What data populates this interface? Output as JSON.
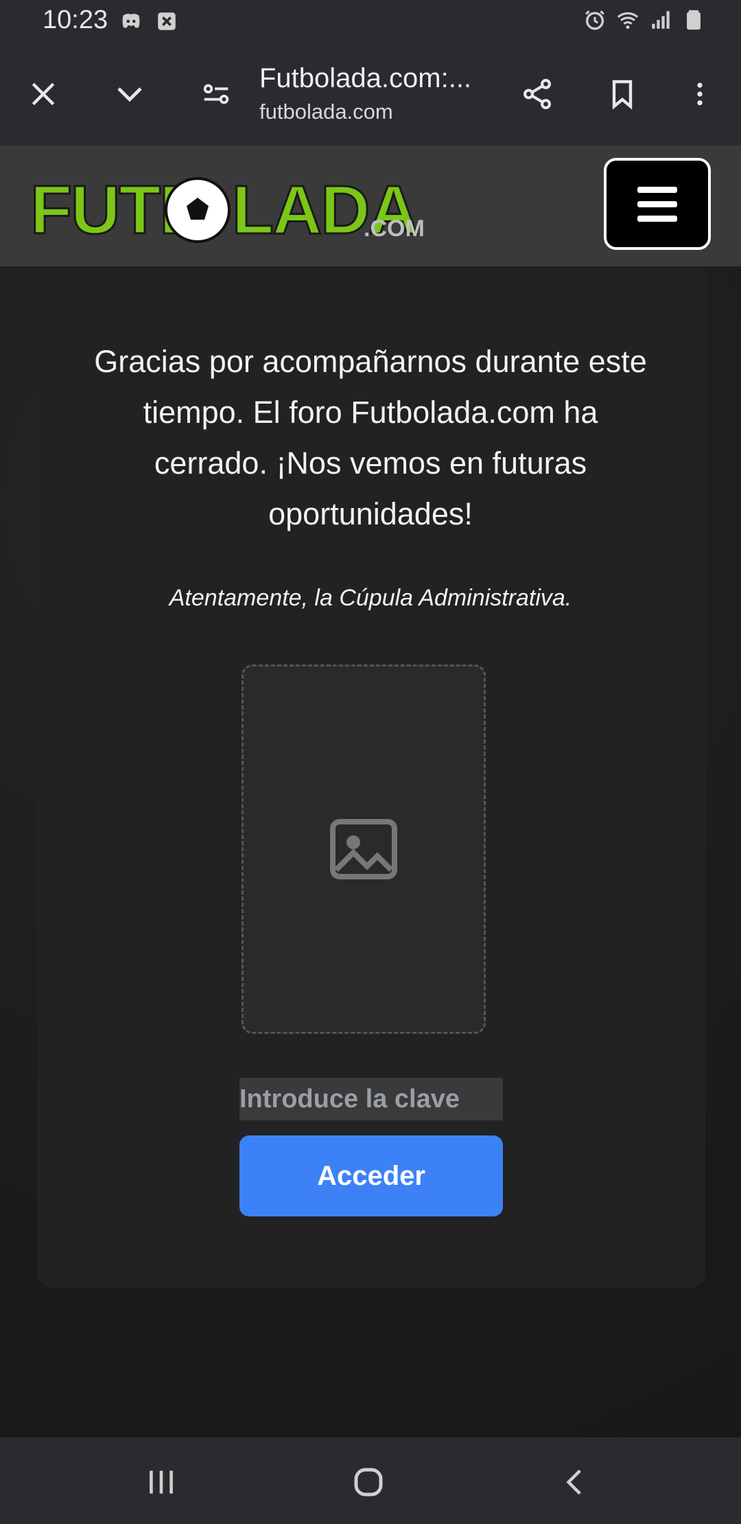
{
  "status_bar": {
    "time": "10:23",
    "left_icons": [
      "discord-icon",
      "app-notification-icon"
    ],
    "right_icons": [
      "alarm-icon",
      "wifi-icon",
      "signal-icon",
      "battery-icon"
    ]
  },
  "browser": {
    "page_title": "Futbolada.com:...",
    "domain": "futbolada.com",
    "icons": [
      "close-icon",
      "chevron-down-icon",
      "site-settings-icon",
      "share-icon",
      "bookmark-icon",
      "more-options-icon"
    ]
  },
  "site": {
    "logo_text": "FUTBOLADA",
    "logo_suffix": ".com",
    "brand_color": "#7cc618"
  },
  "content": {
    "message": "Gracias por acompañarnos durante este tiempo. El foro Futbolada.com ha cerrado. ¡Nos vemos en futuras oportunidades!",
    "signature": "Atentamente, la Cúpula Administrativa.",
    "image_note": "Imagen omitida"
  },
  "form": {
    "password_placeholder": "Introduce la clave",
    "submit_label": "Acceder",
    "button_color": "#3c82f6"
  },
  "nav_bar": {
    "icons": [
      "recent-apps-icon",
      "home-icon",
      "back-icon"
    ]
  }
}
